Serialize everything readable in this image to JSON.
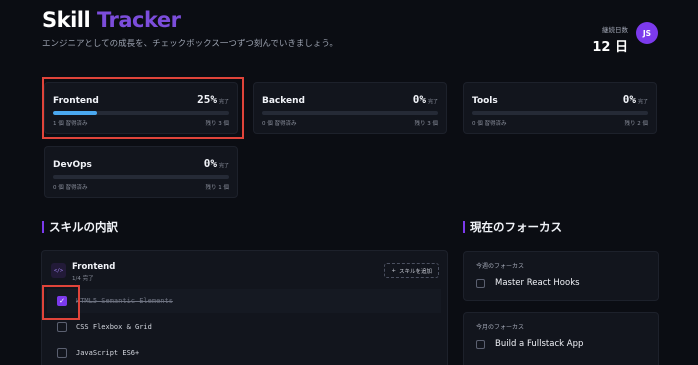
{
  "header": {
    "title_main": "Skill",
    "title_accent": "Tracker",
    "subtitle": "エンジニアとしての成長を、チェックボックス一つずつ刻んでいきましょう。",
    "streak_label": "継続日数",
    "streak_value": "12 日",
    "avatar_initials": "JS"
  },
  "categories": [
    {
      "name": "Frontend",
      "percent": "25%",
      "unit": "完了",
      "progress": 25,
      "done": "1 個 習得済み",
      "remaining": "残り 3 個"
    },
    {
      "name": "Backend",
      "percent": "0%",
      "unit": "完了",
      "progress": 0,
      "done": "0 個 習得済み",
      "remaining": "残り 3 個"
    },
    {
      "name": "Tools",
      "percent": "0%",
      "unit": "完了",
      "progress": 0,
      "done": "0 個 習得済み",
      "remaining": "残り 2 個"
    },
    {
      "name": "DevOps",
      "percent": "0%",
      "unit": "完了",
      "progress": 0,
      "done": "0 個 習得済み",
      "remaining": "残り 1 個"
    }
  ],
  "sections": {
    "breakdown_title": "スキルの内訳",
    "focus_title": "現在のフォーカス"
  },
  "skill_group": {
    "icon": "</>",
    "name": "Frontend",
    "count": "1/4 完了",
    "add_label": "スキルを追加",
    "skills": [
      {
        "name": "HTML5 Semantic Elements",
        "checked": true
      },
      {
        "name": "CSS Flexbox & Grid",
        "checked": false
      },
      {
        "name": "JavaScript ES6+",
        "checked": false
      }
    ]
  },
  "focus": [
    {
      "label": "今週のフォーカス",
      "item": "Master React Hooks"
    },
    {
      "label": "今月のフォーカス",
      "item": "Build a Fullstack App"
    }
  ],
  "colors": {
    "accent": "#7c3aed",
    "progress": "#4aa8f0",
    "highlight": "#e0443a"
  }
}
